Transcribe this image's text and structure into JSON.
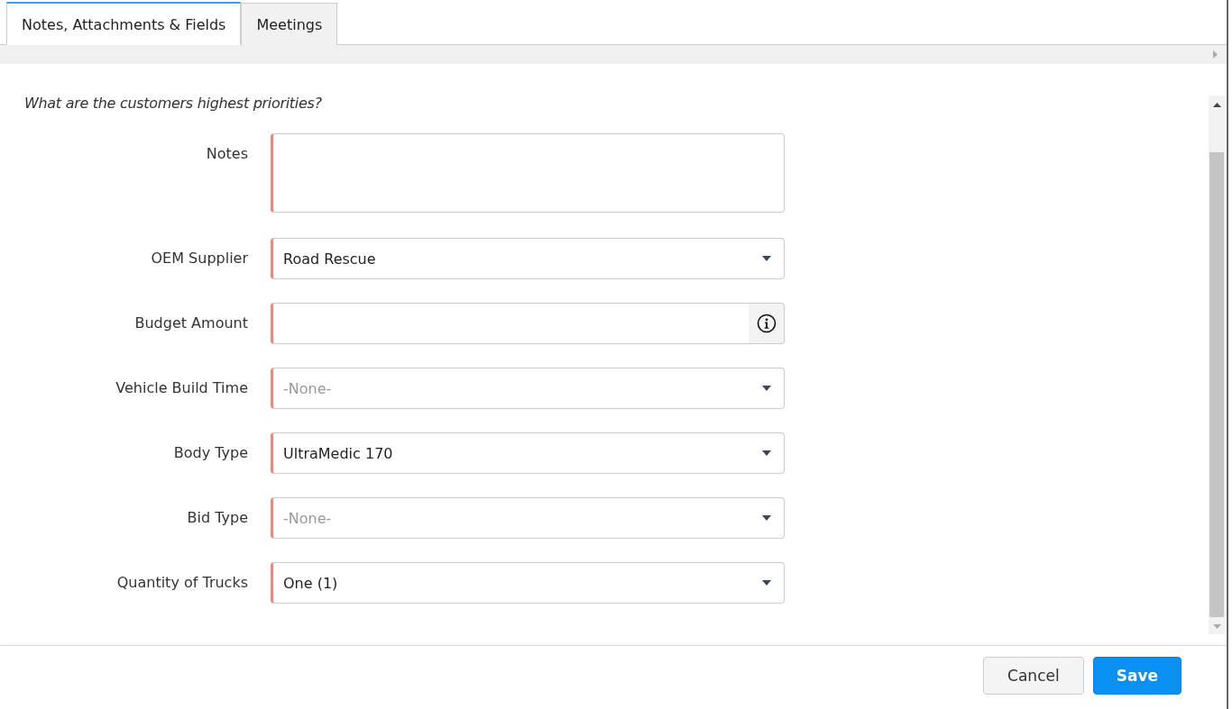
{
  "tabs": [
    {
      "label": "Notes, Attachments & Fields",
      "selected": true
    },
    {
      "label": "Meetings",
      "selected": false
    }
  ],
  "question": "What are the customers highest priorities?",
  "fields": [
    {
      "label": "Notes",
      "kind": "textarea",
      "required": true
    },
    {
      "label": "OEM Supplier",
      "kind": "select",
      "required": true,
      "value": "Road Rescue"
    },
    {
      "label": "Budget Amount",
      "kind": "info-input",
      "required": true
    },
    {
      "label": "Vehicle Build Time",
      "kind": "select",
      "required": true,
      "placeholder": "-None-"
    },
    {
      "label": "Body Type",
      "kind": "select",
      "required": true,
      "value": "UltraMedic 170"
    },
    {
      "label": "Bid Type",
      "kind": "select",
      "required": true,
      "placeholder": "-None-"
    },
    {
      "label": "Quantity of Trucks",
      "kind": "select",
      "required": true,
      "value": "One (1)"
    }
  ],
  "buttons": [
    {
      "label": "Cancel",
      "kind": "secondary"
    },
    {
      "label": "Save",
      "kind": "primary"
    }
  ]
}
